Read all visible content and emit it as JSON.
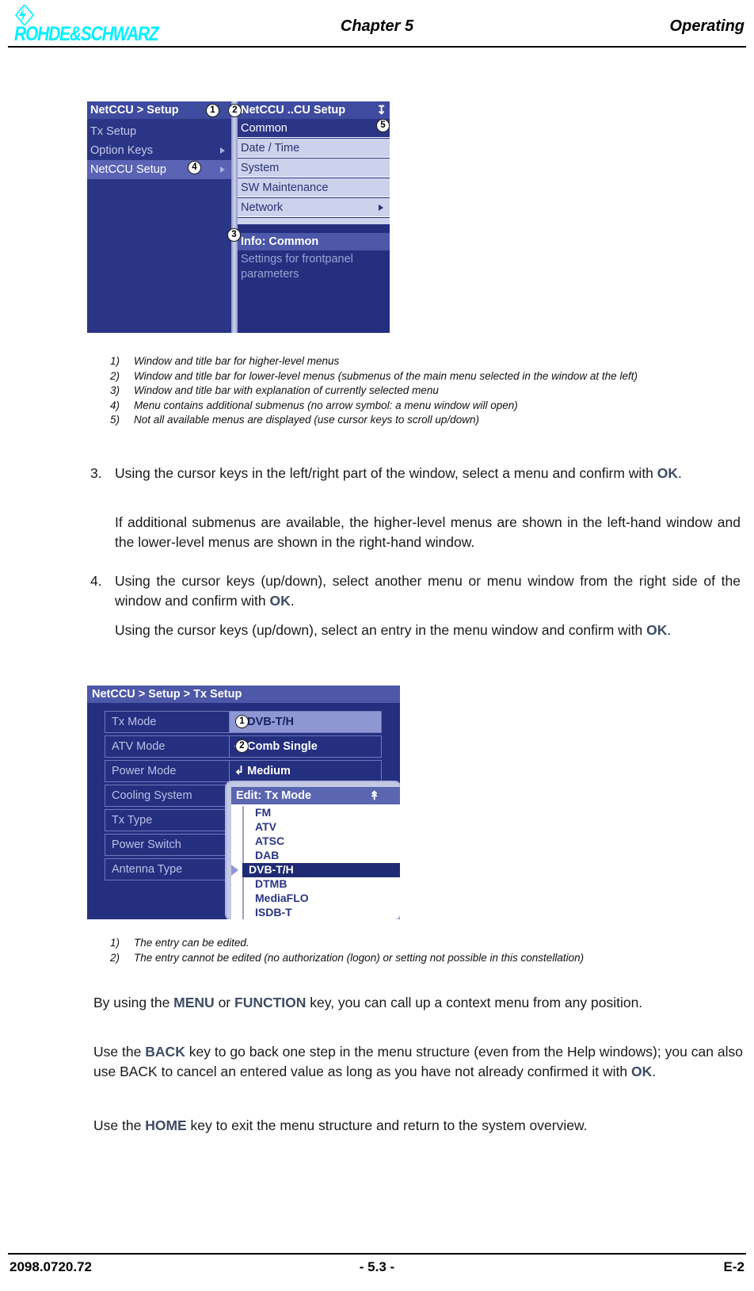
{
  "header": {
    "brand": "ROHDE&SCHWARZ",
    "chapter": "Chapter 5",
    "right": "Operating"
  },
  "footer": {
    "doc_number": "2098.0720.72",
    "page": "- 5.3 -",
    "edition": "E-2"
  },
  "figure1": {
    "left_window": {
      "title": "NetCCU  > Setup",
      "items": [
        {
          "label": "Tx Setup",
          "arrow": false,
          "selected": false
        },
        {
          "label": "Option Keys",
          "arrow": true,
          "selected": false
        },
        {
          "label": "NetCCU Setup",
          "arrow": true,
          "selected": true
        }
      ]
    },
    "right_window": {
      "title": "NetCCU ..CU Setup",
      "scroll_glyph": "down-arrow",
      "items": [
        {
          "label": "Common",
          "arrow": false,
          "selected": true
        },
        {
          "label": "Date / Time",
          "arrow": false,
          "selected": false
        },
        {
          "label": "System",
          "arrow": false,
          "selected": false
        },
        {
          "label": "SW Maintenance",
          "arrow": false,
          "selected": false
        },
        {
          "label": "Network",
          "arrow": true,
          "selected": false
        }
      ]
    },
    "info_window": {
      "title": "Info: Common",
      "body_line1": "Settings for frontpanel",
      "body_line2": "parameters"
    },
    "callouts": [
      "1",
      "2",
      "3",
      "4",
      "5"
    ]
  },
  "figure1_captions": [
    {
      "num": "1)",
      "text": "Window and title bar for higher-level menus"
    },
    {
      "num": "2)",
      "text": "Window and title bar for lower-level menus (submenus of the main menu selected in the window at the left)"
    },
    {
      "num": "3)",
      "text": "Window and title bar with explanation of currently selected menu"
    },
    {
      "num": "4)",
      "text": "Menu contains additional submenus (no arrow symbol: a menu window will open)"
    },
    {
      "num": "5)",
      "text": "Not all available menus are displayed (use cursor keys to scroll up/down)"
    }
  ],
  "steps": {
    "step3_marker": "3.",
    "step3_part1": "Using the cursor keys in the left/right part of the window, select a menu and confirm with ",
    "step3_kw": "OK",
    "step3_part2": ".",
    "step3_note": "If additional submenus are available, the higher-level menus are shown in the left-hand window and the lower-level menus are shown in the right-hand window.",
    "step4_marker": "4.",
    "step4_part1": "Using the cursor keys (up/down), select another menu or menu window from the right side of the window and confirm with ",
    "step4_kw": "OK",
    "step4_part2": ".",
    "step4_note_part1": "Using the cursor keys (up/down), select an entry in the menu window and confirm with ",
    "step4_note_kw": "OK",
    "step4_note_part2": "."
  },
  "figure2": {
    "title": "NetCCU  > Setup > Tx Setup",
    "rows": [
      {
        "label": "Tx Mode",
        "glyph": "enter-arrow",
        "value": "DVB-T/H",
        "highlighted": true,
        "callout": "1"
      },
      {
        "label": "ATV Mode",
        "glyph": "locked",
        "value": "Comb Single",
        "highlighted": false,
        "callout": "2"
      },
      {
        "label": "Power Mode",
        "glyph": "enter-arrow",
        "value": "Medium",
        "highlighted": false,
        "callout": ""
      },
      {
        "label": "Cooling System",
        "glyph": "",
        "value": "",
        "highlighted": false,
        "callout": ""
      },
      {
        "label": "Tx Type",
        "glyph": "",
        "value": "",
        "highlighted": false,
        "callout": ""
      },
      {
        "label": "Power Switch",
        "glyph": "",
        "value": "",
        "highlighted": false,
        "callout": ""
      },
      {
        "label": "Antenna Type",
        "glyph": "",
        "value": "",
        "highlighted": false,
        "callout": ""
      }
    ],
    "popup": {
      "title": "Edit: Tx Mode",
      "scroll_glyph": "up-arrow",
      "options": [
        {
          "label": "FM",
          "selected": false
        },
        {
          "label": "ATV",
          "selected": false
        },
        {
          "label": "ATSC",
          "selected": false
        },
        {
          "label": "DAB",
          "selected": false
        },
        {
          "label": "DVB-T/H",
          "selected": true
        },
        {
          "label": "DTMB",
          "selected": false
        },
        {
          "label": "MediaFLO",
          "selected": false
        },
        {
          "label": "ISDB-T",
          "selected": false
        }
      ]
    }
  },
  "figure2_captions": [
    {
      "num": "1)",
      "text": "The entry can be edited."
    },
    {
      "num": "2)",
      "text": "The entry cannot be edited (no authorization (logon) or setting not possible in this constellation)"
    }
  ],
  "closing": {
    "p1_part1": "By using the ",
    "p1_kw1": "MENU",
    "p1_part2": " or ",
    "p1_kw2": "FUNCTION",
    "p1_part3": " key, you can call up a context menu from any position.",
    "p2_part1": "Use the ",
    "p2_kw1": "BACK",
    "p2_part2": " key to go back one step in the menu structure (even from the Help windows); you can also use BACK to cancel an entered value as long as you have not already confirmed it with ",
    "p2_kw2": "OK",
    "p2_part3": ".",
    "p3_part1": "Use the ",
    "p3_kw1": "HOME",
    "p3_part2": " key to exit the menu structure and return to the system overview."
  },
  "colors": {
    "brand_cyan": "#00f0ff",
    "keyword_blue": "#3d4b63",
    "ui_dark_blue": "#252f80",
    "ui_title_blue": "#4d58a8",
    "ui_light_row": "#ccd2ec"
  }
}
